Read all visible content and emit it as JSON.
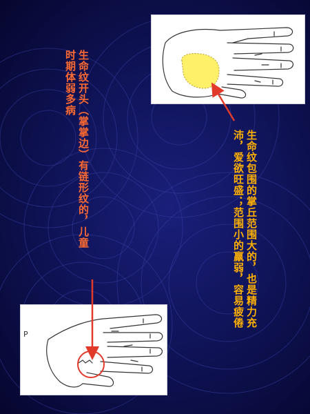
{
  "slide": {
    "text_top": {
      "line1": "生命纹包围的掌丘范围大的，也是精力充",
      "line2": "沛，爱欲旺盛；范围小的羸弱，容易疲倦"
    },
    "text_left": {
      "line1": "生命纹开头（掌掌边）有链形纹的，儿童",
      "line2": "时期体弱多病"
    },
    "panel_bottom_label": "P",
    "colors": {
      "background": "#10145a",
      "text_top": "#ffb000",
      "text_left": "#ff6a30",
      "arrow": "#e23a2a",
      "highlight_fill": "#fff06a"
    }
  }
}
